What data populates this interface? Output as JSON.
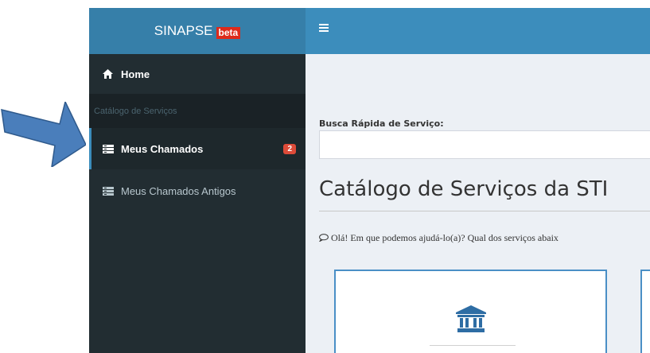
{
  "brand": {
    "name": "SINAPSE",
    "badge": "beta"
  },
  "sidebar": {
    "home": "Home",
    "section_header": "Catálogo de Serviços",
    "items": [
      {
        "label": "Meus Chamados",
        "badge": "2"
      },
      {
        "label": "Meus Chamados Antigos"
      }
    ]
  },
  "main": {
    "search_label": "Busca Rápida de Serviço:",
    "search_value": "",
    "title": "Catálogo de Serviços da STI",
    "intro": "Olá! Em que podemos ajudá-lo(a)? Qual dos serviços abaix"
  },
  "colors": {
    "brand_bg": "#367fa9",
    "topbar_bg": "#3c8dbc",
    "sidebar_bg": "#222d32",
    "badge_red": "#dd4b39",
    "annotation_arrow": "#4a7ebb"
  },
  "icons": [
    "home-icon",
    "list-icon",
    "menu-icon",
    "comment-icon",
    "institution-icon",
    "annotation-arrow"
  ]
}
